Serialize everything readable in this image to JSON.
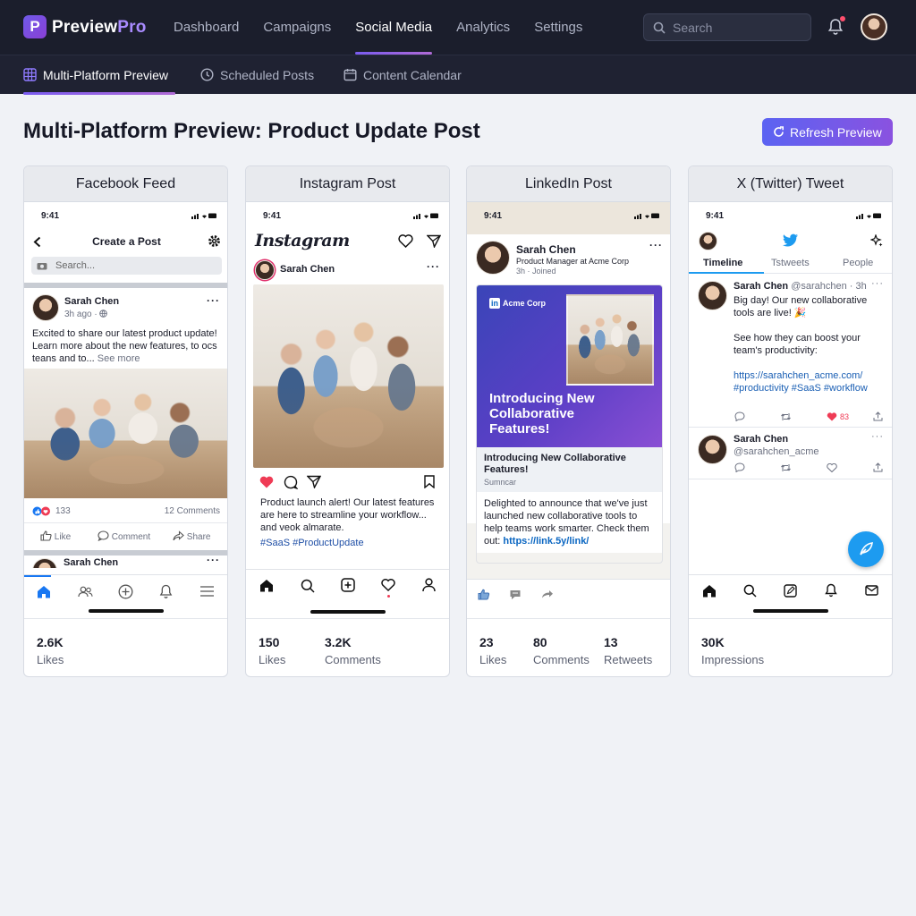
{
  "brand": {
    "logo_letter": "P",
    "name_a": "Preview",
    "name_b": "Pro"
  },
  "nav": {
    "items": [
      "Dashboard",
      "Campaigns",
      "Social Media",
      "Analytics",
      "Settings"
    ],
    "active": "Social Media"
  },
  "search": {
    "placeholder": "Search"
  },
  "subnav": {
    "tabs": [
      "Multi-Platform Preview",
      "Scheduled Posts",
      "Content Calendar"
    ],
    "active": "Multi-Platform Preview"
  },
  "page": {
    "title": "Multi-Platform Preview: Product Update Post",
    "refresh_label": "Refresh Preview"
  },
  "colors": {
    "accent": "#6b5cf0",
    "nav_bg": "#1b1e2c",
    "twitter": "#1d9bf0",
    "like_red": "#ef3b55"
  },
  "phone_time": "9:41",
  "facebook": {
    "card_title": "Facebook Feed",
    "header": "Create a Post",
    "search_placeholder": "Search...",
    "author": "Sarah Chen",
    "meta": "3h ago · ",
    "text": "Excited to share our latest product update! Learn more about the new features, to ocs teans and to...",
    "see_more": "See more",
    "reactions": "133",
    "comments": "12 Comments",
    "actions": [
      "Like",
      "Comment",
      "Share"
    ],
    "next_author": "Sarah Chen",
    "stats": [
      {
        "value": "2.6K",
        "label": "Likes"
      }
    ]
  },
  "instagram": {
    "card_title": "Instagram Post",
    "logo": "Instagram",
    "author": "Sarah Chen",
    "caption": "Product launch alert! Our latest features are here to streamline your workflow... and veok almarate.",
    "hashtags": "#SaaS #ProductUpdate",
    "stats": [
      {
        "value": "150",
        "label": "Likes"
      },
      {
        "value": "3.2K",
        "label": "Comments"
      }
    ]
  },
  "linkedin": {
    "card_title": "LinkedIn Post",
    "author": "Sarah Chen",
    "headline": "Product Manager at Acme Corp",
    "meta": "3h · Joined",
    "company_badge": "Acme Corp",
    "banner_text": "Introducing New Collaborative Features!",
    "link_title": "Introducing New Collaborative Features!",
    "link_sub": "Sumncar",
    "body": "Delighted to announce that we've just launched new collaborative tools to help teams work smarter. Check them out: ",
    "link": "https://link.5y/link/",
    "stats": [
      {
        "value": "23",
        "label": "Likes"
      },
      {
        "value": "80",
        "label": "Comments"
      },
      {
        "value": "13",
        "label": "Retweets"
      }
    ]
  },
  "twitter": {
    "card_title": "X (Twitter) Tweet",
    "tabs": [
      "Timeline",
      "Tstweets",
      "People"
    ],
    "author": "Sarah Chen",
    "handle_time": "@sarahchen · 3h",
    "text1": "Big day! Our new collaborative tools are live! 🎉",
    "text2": "See how they can boost your team's productivity:",
    "link": "https://sarahchen_acme.com/ #productivity #SaaS #workflow",
    "likes": "83",
    "author2": "Sarah Chen",
    "handle2": "@sarahchen_acme",
    "stats": [
      {
        "value": "30K",
        "label": "Impressions"
      }
    ]
  }
}
